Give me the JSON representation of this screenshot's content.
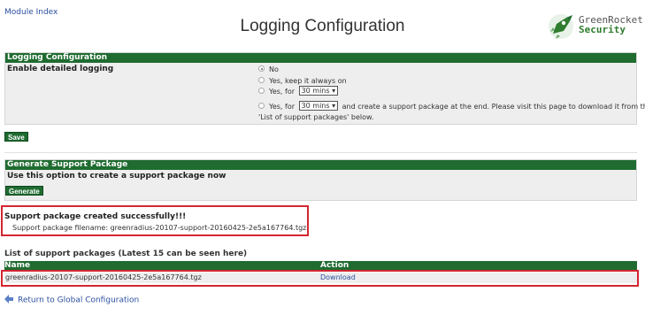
{
  "header": {
    "module_index": "Module Index",
    "title": "Logging Configuration",
    "logo": {
      "line1": "GreenRocket",
      "line2": "Security"
    }
  },
  "logging": {
    "header": "Logging Configuration",
    "label": "Enable detailed logging",
    "options": [
      {
        "text": "No",
        "selected": true
      },
      {
        "text": "Yes, keep it always on",
        "selected": false
      },
      {
        "text_before": "Yes, for",
        "select": "30 mins ▾",
        "selected": false
      },
      {
        "text_before": "Yes, for",
        "select": "30 mins ▾",
        "text_after": "and create a support package at the end. Please visit this page to download it from the",
        "selected": false
      }
    ],
    "continuation": "'List of support packages' below.",
    "save_label": "Save"
  },
  "generate": {
    "header": "Generate Support Package",
    "label": "Use this option to create a support package now",
    "button": "Generate"
  },
  "success": {
    "title": "Support package created successfully!!!",
    "filename_line": "Support package filename: greenradius-20107-support-20160425-2e5a167764.tgz"
  },
  "packages": {
    "title": "List of support packages (Latest 15 can be seen here)",
    "columns": [
      "Name",
      "Action"
    ],
    "rows": [
      {
        "name": "greenradius-20107-support-20160425-2e5a167764.tgz",
        "action": "Download"
      }
    ]
  },
  "footer": {
    "return_link": "Return to Global Configuration"
  },
  "colors": {
    "header_green": "#1f6b30",
    "highlight_red": "#d32630",
    "link_blue": "#2b4f9f",
    "panel_bg": "#eeeeee"
  }
}
